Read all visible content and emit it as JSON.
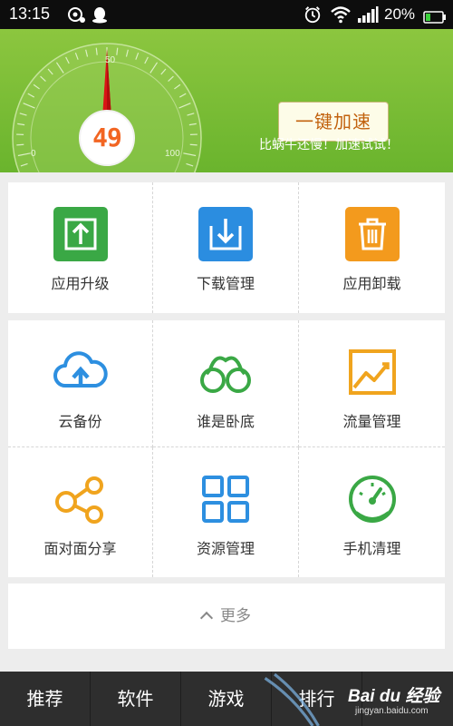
{
  "status_bar": {
    "time": "13:15",
    "battery_percent": "20%",
    "icons": [
      "baidu-app-icon",
      "qq-icon",
      "alarm-icon",
      "wifi-icon",
      "signal-icon",
      "battery-icon"
    ]
  },
  "header": {
    "speed_value": "49",
    "gauge_min": "0",
    "gauge_mid": "50",
    "gauge_max": "100",
    "accelerate_button": "一键加速",
    "hint": "比蜗牛还慢！加速试试！"
  },
  "tools_top": [
    {
      "label": "应用升级",
      "icon": "app-upgrade-icon",
      "color": "#3aa845"
    },
    {
      "label": "下载管理",
      "icon": "download-manager-icon",
      "color": "#2b8de0"
    },
    {
      "label": "应用卸载",
      "icon": "app-uninstall-trash-icon",
      "color": "#f39a1d"
    }
  ],
  "tools_grid": [
    {
      "label": "云备份",
      "icon": "cloud-backup-icon",
      "color": "#2d8fe0"
    },
    {
      "label": "谁是卧底",
      "icon": "handcuffs-icon",
      "color": "#3aa845"
    },
    {
      "label": "流量管理",
      "icon": "traffic-chart-icon",
      "color": "#f0a41e"
    },
    {
      "label": "面对面分享",
      "icon": "share-nodes-icon",
      "color": "#f0a41e"
    },
    {
      "label": "资源管理",
      "icon": "resource-grid-icon",
      "color": "#2d8fe0"
    },
    {
      "label": "手机清理",
      "icon": "phone-clean-gauge-icon",
      "color": "#3aa845"
    }
  ],
  "more_label": "更多",
  "bottom_tabs": [
    "推荐",
    "软件",
    "游戏",
    "排行",
    ""
  ],
  "watermark": {
    "brand": "Bai du 经验",
    "url": "jingyan.baidu.com"
  },
  "colors": {
    "header_green": "#79bd35",
    "needle_red": "#e01b1b",
    "speed_orange": "#f26522",
    "nav_bg": "#2e2e2e"
  }
}
